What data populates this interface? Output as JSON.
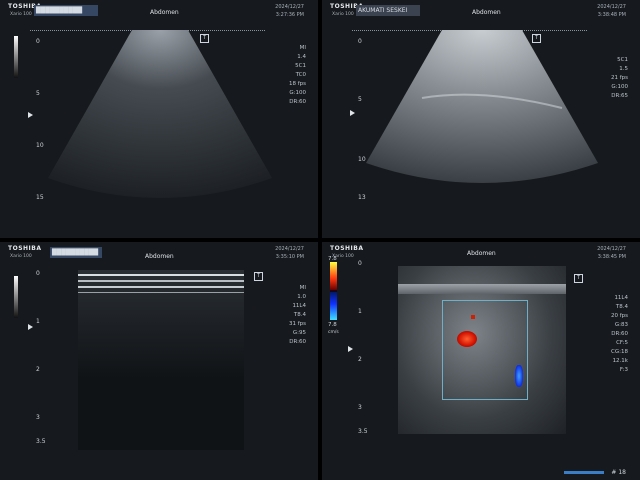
{
  "panels": [
    {
      "brand": "TOSHIBA",
      "model": "Xario 100",
      "patient_id": "██████████",
      "exam": "Abdomen",
      "date": "2024/12/27",
      "time": "3:27:36 PM",
      "depth_ticks": [
        "0",
        "5",
        "10",
        "15"
      ],
      "params": [
        "MI",
        "1.4",
        "5C1",
        "TC0",
        "18 fps",
        "G:100",
        "DR:60"
      ],
      "t_marker": "T"
    },
    {
      "brand": "TOSHIBA",
      "model": "Xario 100",
      "patient_id": "AKUMATI SESKEI",
      "exam": "Abdomen",
      "date": "2024/12/27",
      "time": "3:38:48 PM",
      "depth_ticks": [
        "0",
        "5",
        "10",
        "13"
      ],
      "params": [
        "5C1",
        "1.5",
        "21 fps",
        "G:100",
        "DR:65"
      ],
      "t_marker": "T"
    },
    {
      "brand": "TOSHIBA",
      "model": "Xario 100",
      "patient_id": "██████████",
      "exam": "Abdomen",
      "date": "2024/12/27",
      "time": "3:35:10 PM",
      "depth_ticks": [
        "0",
        "1",
        "2",
        "3",
        "3.5"
      ],
      "params": [
        "MI",
        "1.0",
        "11L4",
        "T8.4",
        "31 fps",
        "G:95",
        "DR:60"
      ],
      "t_marker": "T"
    },
    {
      "brand": "TOSHIBA",
      "model": "Xario 100",
      "patient_id": "",
      "exam": "Abdomen",
      "date": "2024/12/27",
      "time": "3:38:45 PM",
      "depth_ticks": [
        "0",
        "1",
        "2",
        "3",
        "3.5"
      ],
      "params": [
        "11L4",
        "T8.4",
        "20 fps",
        "G:83",
        "DR:60",
        "CF:5",
        "CG:18",
        "12.1k",
        "F:3"
      ],
      "color_scale_top": "7.8",
      "color_scale_bottom": "7.8",
      "color_scale_unit": "cm/s",
      "t_marker": "T",
      "frame_counter": "# 18"
    }
  ]
}
